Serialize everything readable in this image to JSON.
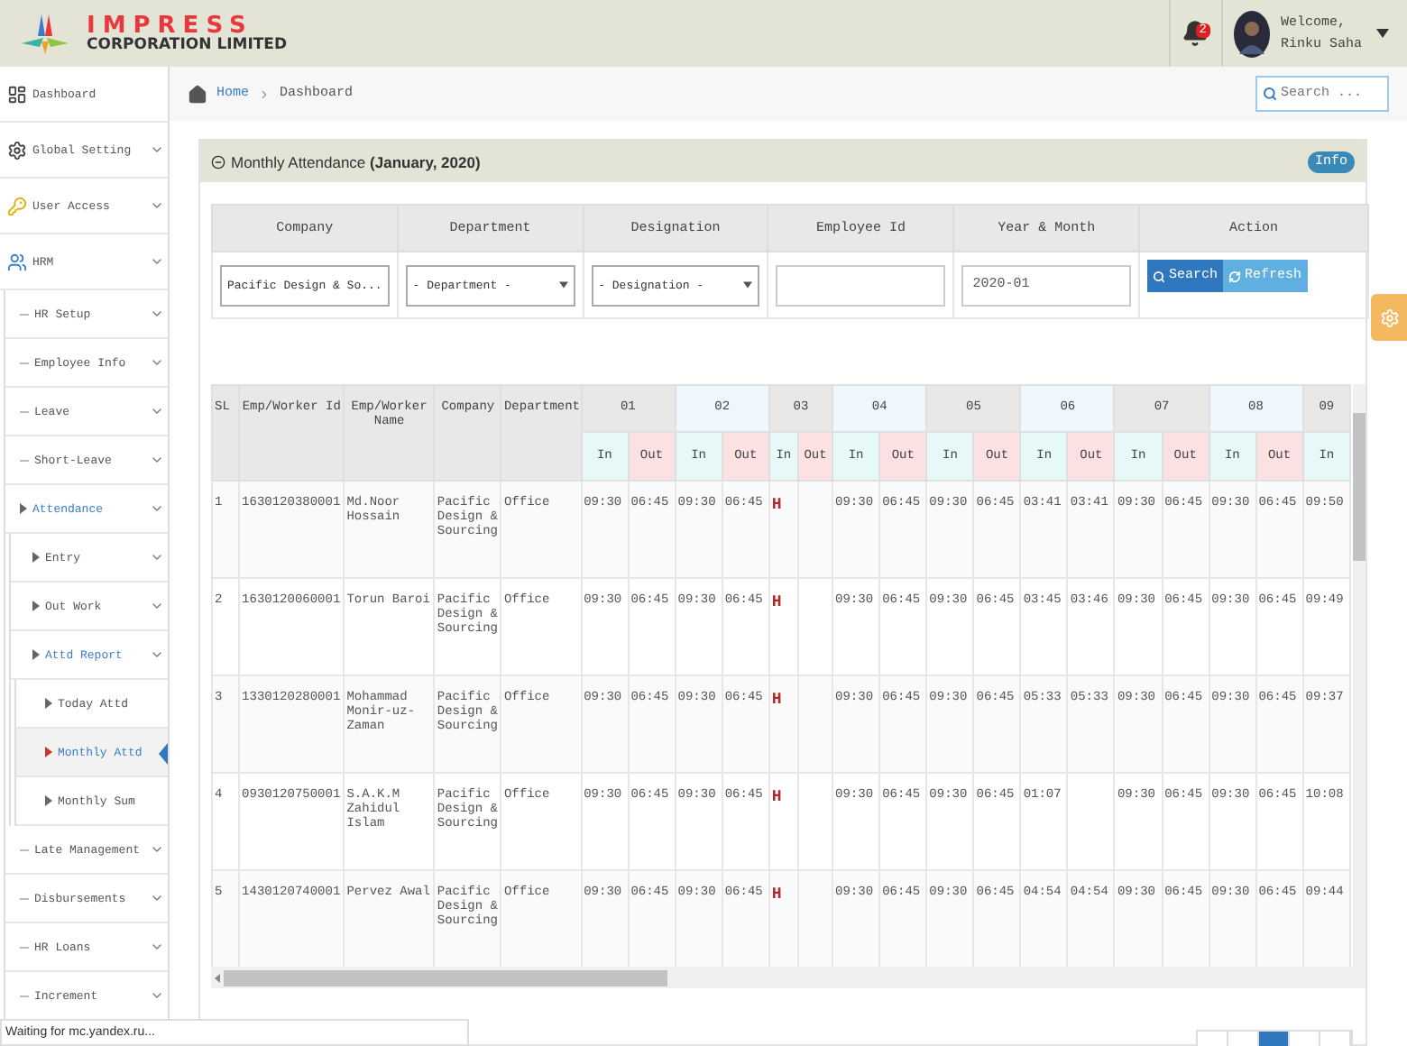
{
  "header": {
    "brand": "IMPRESS",
    "brand_sub": "CORPORATION LIMITED",
    "notifications": "2",
    "welcome": "Welcome,",
    "user": "Rinku Saha"
  },
  "sidebar": {
    "items": [
      {
        "label": "Dashboard",
        "submenu": false,
        "active": false,
        "selected": false
      },
      {
        "label": "Global Setting",
        "submenu": true,
        "active": false,
        "selected": false
      },
      {
        "label": "User Access",
        "submenu": true,
        "active": false,
        "selected": false
      },
      {
        "label": "HRM",
        "submenu": true,
        "active": false,
        "selected": false,
        "children": [
          {
            "label": "HR Setup",
            "submenu": true,
            "active": false,
            "selected": false
          },
          {
            "label": "Employee Info",
            "submenu": true,
            "active": false,
            "selected": false
          },
          {
            "label": "Leave",
            "submenu": true,
            "active": false,
            "selected": false
          },
          {
            "label": "Short-Leave",
            "submenu": true,
            "active": false,
            "selected": false
          },
          {
            "label": "Attendance",
            "submenu": true,
            "active": true,
            "selected": false,
            "children": [
              {
                "label": "Entry",
                "submenu": true,
                "active": false,
                "selected": false
              },
              {
                "label": "Out Work",
                "submenu": true,
                "active": false,
                "selected": false
              },
              {
                "label": "Attd Report",
                "submenu": true,
                "active": true,
                "selected": false,
                "children": [
                  {
                    "label": "Today Attd",
                    "submenu": false,
                    "active": false,
                    "selected": false
                  },
                  {
                    "label": "Monthly Attd",
                    "submenu": false,
                    "active": true,
                    "selected": true
                  },
                  {
                    "label": "Monthly Sum",
                    "submenu": false,
                    "active": false,
                    "selected": false
                  }
                ]
              }
            ]
          },
          {
            "label": "Late Management",
            "submenu": true,
            "active": false,
            "selected": false
          },
          {
            "label": "Disbursements",
            "submenu": true,
            "active": false,
            "selected": false
          },
          {
            "label": "HR Loans",
            "submenu": true,
            "active": false,
            "selected": false
          },
          {
            "label": "Increment",
            "submenu": true,
            "active": false,
            "selected": false
          }
        ]
      }
    ]
  },
  "breadcrumb": [
    "Home",
    "Dashboard"
  ],
  "search": {
    "placeholder": "Search ..."
  },
  "panel": {
    "title": "Monthly Attendance  **(January, 2020)**",
    "info": "Info"
  },
  "filters": {
    "columns": [
      "Company",
      "Department",
      "Designation",
      "Employee Id",
      "Year & Month",
      "Action"
    ],
    "company": "Pacific Design & So...",
    "department": "- Department -",
    "designation": "- Designation -",
    "year_month": "2020-01",
    "buttons": [
      {
        "kind": "search",
        "label": "Search"
      },
      {
        "kind": "refresh",
        "label": "Refresh"
      }
    ]
  },
  "table": {
    "columns": [
      "SL",
      "Emp/Worker Id",
      "Emp/Worker Name",
      "Company",
      "Department"
    ],
    "days": [
      {
        "label": "01",
        "in": "In",
        "out": "Out"
      },
      {
        "label": "02",
        "in": "In",
        "out": "Out"
      },
      {
        "label": "03",
        "in": "In",
        "out": "Out"
      },
      {
        "label": "04",
        "in": "In",
        "out": "Out"
      },
      {
        "label": "05",
        "in": "In",
        "out": "Out"
      },
      {
        "label": "06",
        "in": "In",
        "out": "Out"
      },
      {
        "label": "07",
        "in": "In",
        "out": "Out"
      },
      {
        "label": "08",
        "in": "In",
        "out": "Out"
      },
      {
        "label": "09",
        "in": "In"
      }
    ],
    "rows": [
      {
        "sl": "1",
        "id": "1630120380001",
        "name": "Md.Noor Hossain",
        "company": "Pacific Design & Sourcing",
        "department": "Office",
        "days": [
          {
            "kind": "time",
            "in": "09:30",
            "out": "06:45"
          },
          {
            "kind": "time",
            "in": "09:30",
            "out": "06:45"
          },
          {
            "kind": "holiday",
            "mark": "H"
          },
          {
            "kind": "time",
            "in": "09:30",
            "out": "06:45"
          },
          {
            "kind": "time",
            "in": "09:30",
            "out": "06:45"
          },
          {
            "kind": "time",
            "in": "03:41",
            "out": "03:41"
          },
          {
            "kind": "time",
            "in": "09:30",
            "out": "06:45"
          },
          {
            "kind": "time",
            "in": "09:30",
            "out": "06:45"
          },
          {
            "kind": "time",
            "in": "09:50"
          }
        ]
      },
      {
        "sl": "2",
        "id": "1630120060001",
        "name": "Torun Baroi",
        "company": "Pacific Design & Sourcing",
        "department": "Office",
        "days": [
          {
            "kind": "time",
            "in": "09:30",
            "out": "06:45"
          },
          {
            "kind": "time",
            "in": "09:30",
            "out": "06:45"
          },
          {
            "kind": "holiday",
            "mark": "H"
          },
          {
            "kind": "time",
            "in": "09:30",
            "out": "06:45"
          },
          {
            "kind": "time",
            "in": "09:30",
            "out": "06:45"
          },
          {
            "kind": "time",
            "in": "03:45",
            "out": "03:46"
          },
          {
            "kind": "time",
            "in": "09:30",
            "out": "06:45"
          },
          {
            "kind": "time",
            "in": "09:30",
            "out": "06:45"
          },
          {
            "kind": "time",
            "in": "09:49"
          }
        ]
      },
      {
        "sl": "3",
        "id": "1330120280001",
        "name": "Mohammad Monir-uz-Zaman",
        "company": "Pacific Design & Sourcing",
        "department": "Office",
        "days": [
          {
            "kind": "time",
            "in": "09:30",
            "out": "06:45"
          },
          {
            "kind": "time",
            "in": "09:30",
            "out": "06:45"
          },
          {
            "kind": "holiday",
            "mark": "H"
          },
          {
            "kind": "time",
            "in": "09:30",
            "out": "06:45"
          },
          {
            "kind": "time",
            "in": "09:30",
            "out": "06:45"
          },
          {
            "kind": "time",
            "in": "05:33",
            "out": "05:33"
          },
          {
            "kind": "time",
            "in": "09:30",
            "out": "06:45"
          },
          {
            "kind": "time",
            "in": "09:30",
            "out": "06:45"
          },
          {
            "kind": "time",
            "in": "09:37"
          }
        ]
      },
      {
        "sl": "4",
        "id": "0930120750001",
        "name": "S.A.K.M Zahidul Islam",
        "company": "Pacific Design & Sourcing",
        "department": "Office",
        "days": [
          {
            "kind": "time",
            "in": "09:30",
            "out": "06:45"
          },
          {
            "kind": "time",
            "in": "09:30",
            "out": "06:45"
          },
          {
            "kind": "holiday",
            "mark": "H"
          },
          {
            "kind": "time",
            "in": "09:30",
            "out": "06:45"
          },
          {
            "kind": "time",
            "in": "09:30",
            "out": "06:45"
          },
          {
            "kind": "time",
            "in": "01:07"
          },
          {
            "kind": "time",
            "in": "09:30",
            "out": "06:45"
          },
          {
            "kind": "time",
            "in": "09:30",
            "out": "06:45"
          },
          {
            "kind": "time",
            "in": "10:08"
          }
        ]
      },
      {
        "sl": "5",
        "id": "1430120740001",
        "name": "Pervez Awal",
        "company": "Pacific Design & Sourcing",
        "department": "Office",
        "days": [
          {
            "kind": "time",
            "in": "09:30",
            "out": "06:45"
          },
          {
            "kind": "time",
            "in": "09:30",
            "out": "06:45"
          },
          {
            "kind": "holiday",
            "mark": "H"
          },
          {
            "kind": "time",
            "in": "09:30",
            "out": "06:45"
          },
          {
            "kind": "time",
            "in": "09:30",
            "out": "06:45"
          },
          {
            "kind": "time",
            "in": "04:54",
            "out": "04:54"
          },
          {
            "kind": "time",
            "in": "09:30",
            "out": "06:45"
          },
          {
            "kind": "time",
            "in": "09:30",
            "out": "06:45"
          },
          {
            "kind": "time",
            "in": "09:44"
          }
        ]
      }
    ]
  },
  "pagination": [
    {
      "selected": false
    },
    {
      "selected": false
    },
    {
      "selected": true
    },
    {
      "selected": false
    },
    {
      "selected": false
    }
  ],
  "status_bar": "Waiting for mc.yandex.ru..."
}
